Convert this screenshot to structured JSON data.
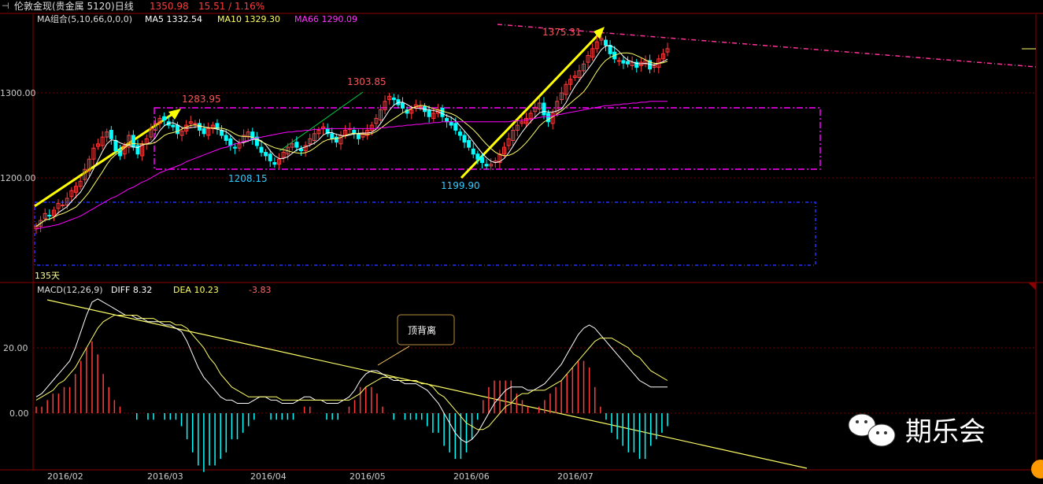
{
  "header": {
    "title": "伦敦金现(贵金属 5120)日线",
    "price": "1350.98",
    "change": "15.51 / 1.16%"
  },
  "ma_legend": {
    "label": "MA组合(5,10,66,0,0,0)",
    "ma5": "MA5 1332.54",
    "ma10": "MA10 1329.30",
    "ma66": "MA66 1290.09"
  },
  "macd_legend": {
    "label": "MACD(12,26,9)",
    "diff": "DIFF 8.32",
    "dea": "DEA 10.23",
    "macd": "-3.83"
  },
  "annotations": {
    "p1": "1283.95",
    "p2": "1303.85",
    "p3": "1375.31",
    "p4": "1208.15",
    "p5": "1199.90",
    "days": "135天",
    "divergence": "顶背离"
  },
  "watermark": {
    "brand": "期乐会"
  },
  "colors": {
    "up": "#ff3c3c",
    "down": "#00ffff",
    "ma5": "#ffffff",
    "ma10": "#ffff66",
    "ma66": "#ff00ff",
    "grid": "#7a0000",
    "arrow": "#ffff00"
  },
  "chart_data": [
    {
      "type": "candlestick",
      "title": "伦敦金现(贵金属 5120)日线",
      "ytick_labels": [
        "1300.00",
        "1200.00"
      ],
      "xtick_labels": [
        "2016/02",
        "2016/03",
        "2016/04",
        "2016/05",
        "2016/06",
        "2016/07"
      ],
      "ylim": [
        1130,
        1400
      ],
      "highs_lows": [
        {
          "label": "1283.95",
          "value": 1283.95
        },
        {
          "label": "1303.85",
          "value": 1303.85
        },
        {
          "label": "1375.31",
          "value": 1375.31
        },
        {
          "label": "1208.15",
          "value": 1208.15
        },
        {
          "label": "1199.90",
          "value": 1199.9
        }
      ],
      "close": [
        1143,
        1150,
        1158,
        1155,
        1162,
        1170,
        1168,
        1176,
        1185,
        1190,
        1196,
        1210,
        1222,
        1235,
        1240,
        1248,
        1254,
        1246,
        1232,
        1226,
        1238,
        1250,
        1236,
        1228,
        1240,
        1246,
        1258,
        1264,
        1270,
        1268,
        1262,
        1260,
        1252,
        1255,
        1262,
        1266,
        1264,
        1256,
        1252,
        1258,
        1262,
        1258,
        1250,
        1244,
        1238,
        1235,
        1240,
        1250,
        1254,
        1246,
        1238,
        1230,
        1226,
        1220,
        1216,
        1222,
        1230,
        1236,
        1240,
        1236,
        1232,
        1238,
        1246,
        1252,
        1256,
        1260,
        1252,
        1246,
        1242,
        1250,
        1256,
        1258,
        1252,
        1246,
        1252,
        1256,
        1262,
        1270,
        1280,
        1290,
        1296,
        1292,
        1286,
        1282,
        1276,
        1280,
        1286,
        1284,
        1278,
        1272,
        1276,
        1280,
        1272,
        1266,
        1262,
        1256,
        1250,
        1242,
        1236,
        1228,
        1222,
        1218,
        1214,
        1216,
        1220,
        1228,
        1236,
        1246,
        1256,
        1262,
        1266,
        1270,
        1276,
        1283,
        1288,
        1274,
        1266,
        1276,
        1290,
        1300,
        1310,
        1316,
        1320,
        1326,
        1334,
        1344,
        1352,
        1360,
        1364,
        1356,
        1346,
        1340,
        1338,
        1335,
        1334,
        1336,
        1330,
        1336,
        1338,
        1328,
        1332,
        1340,
        1346,
        1352
      ],
      "ma66": [
        1140,
        1141,
        1142,
        1143,
        1144,
        1145,
        1147,
        1149,
        1151,
        1153,
        1155,
        1158,
        1161,
        1164,
        1167,
        1170,
        1173,
        1176,
        1178,
        1181,
        1184,
        1187,
        1189,
        1192,
        1195,
        1197,
        1200,
        1203,
        1206,
        1208,
        1210,
        1212,
        1214,
        1216,
        1219,
        1221,
        1223,
        1225,
        1227,
        1229,
        1231,
        1233,
        1235,
        1236,
        1238,
        1240,
        1241,
        1243,
        1244,
        1246,
        1247,
        1248,
        1249,
        1250,
        1251,
        1252,
        1253,
        1254,
        1254,
        1255,
        1255,
        1256,
        1256,
        1257,
        1257,
        1258,
        1258,
        1258,
        1258,
        1258,
        1258,
        1258,
        1258,
        1258,
        1258,
        1258,
        1258,
        1258,
        1259,
        1259,
        1260,
        1260,
        1261,
        1261,
        1262,
        1262,
        1263,
        1263,
        1264,
        1264,
        1265,
        1265,
        1266,
        1266,
        1266,
        1266,
        1266,
        1266,
        1266,
        1266,
        1266,
        1266,
        1266,
        1266,
        1266,
        1266,
        1266,
        1266,
        1267,
        1267,
        1268,
        1268,
        1269,
        1270,
        1271,
        1272,
        1272,
        1273,
        1274,
        1275,
        1276,
        1277,
        1278,
        1279,
        1280,
        1281,
        1282,
        1283,
        1284,
        1285,
        1285,
        1286,
        1286,
        1287,
        1287,
        1288,
        1288,
        1289,
        1289,
        1290,
        1290,
        1290,
        1290,
        1290
      ]
    },
    {
      "type": "bar",
      "title": "MACD(12,26,9)",
      "ytick_labels": [
        "20.00",
        "0.00"
      ],
      "ylim": [
        -12,
        38
      ],
      "series": [
        {
          "name": "DIFF",
          "values": [
            5,
            6,
            8,
            10,
            12,
            14,
            16,
            20,
            25,
            30,
            34,
            35,
            34,
            33,
            32,
            31,
            30,
            30,
            29,
            29,
            28,
            28,
            28,
            27,
            27,
            26,
            25,
            22,
            18,
            14,
            11,
            9,
            7,
            5,
            4,
            4,
            3,
            3,
            3,
            4,
            5,
            5,
            4,
            4,
            3,
            3,
            3,
            4,
            5,
            5,
            4,
            4,
            3,
            3,
            3,
            4,
            5,
            7,
            10,
            12,
            13,
            13,
            12,
            11,
            10,
            10,
            9,
            9,
            9,
            8,
            7,
            5,
            3,
            0,
            -3,
            -6,
            -8,
            -9,
            -8,
            -6,
            -3,
            0,
            3,
            5,
            7,
            8,
            8,
            8,
            7,
            7,
            8,
            9,
            11,
            13,
            15,
            18,
            21,
            24,
            26,
            27,
            26,
            24,
            22,
            20,
            18,
            16,
            14,
            12,
            10,
            9,
            8,
            8,
            8,
            8
          ]
        },
        {
          "name": "DEA",
          "values": [
            4,
            5,
            6,
            7,
            9,
            10,
            12,
            14,
            17,
            20,
            23,
            26,
            28,
            29,
            30,
            30,
            30,
            30,
            30,
            29,
            29,
            29,
            28,
            28,
            28,
            27,
            27,
            26,
            24,
            22,
            20,
            17,
            15,
            12,
            10,
            8,
            7,
            6,
            5,
            5,
            5,
            5,
            5,
            5,
            4,
            4,
            4,
            4,
            4,
            4,
            4,
            4,
            4,
            4,
            4,
            4,
            4,
            5,
            6,
            8,
            9,
            10,
            11,
            11,
            11,
            10,
            10,
            10,
            10,
            9,
            9,
            8,
            6,
            5,
            3,
            1,
            -1,
            -3,
            -4,
            -5,
            -5,
            -4,
            -2,
            0,
            2,
            3,
            5,
            6,
            6,
            7,
            7,
            7,
            8,
            9,
            10,
            12,
            14,
            16,
            18,
            20,
            22,
            23,
            23,
            23,
            22,
            21,
            20,
            18,
            17,
            15,
            13,
            12,
            11,
            10
          ]
        },
        {
          "name": "MACD",
          "values": [
            2,
            2,
            4,
            6,
            6,
            8,
            8,
            12,
            16,
            20,
            22,
            18,
            12,
            8,
            4,
            2,
            0,
            0,
            -2,
            0,
            -2,
            -2,
            0,
            -2,
            -2,
            -2,
            -4,
            -8,
            -12,
            -16,
            -18,
            -16,
            -16,
            -14,
            -12,
            -8,
            -8,
            -6,
            -4,
            -2,
            0,
            0,
            -2,
            -2,
            -2,
            -2,
            -2,
            0,
            2,
            2,
            0,
            0,
            -2,
            -2,
            -2,
            0,
            2,
            4,
            8,
            8,
            8,
            6,
            2,
            0,
            -2,
            0,
            -2,
            -2,
            -2,
            -2,
            -4,
            -6,
            -6,
            -10,
            -12,
            -14,
            -14,
            -12,
            -8,
            -2,
            4,
            8,
            10,
            10,
            10,
            10,
            6,
            4,
            2,
            0,
            2,
            4,
            6,
            8,
            10,
            12,
            14,
            16,
            16,
            14,
            8,
            2,
            -2,
            -6,
            -8,
            -10,
            -12,
            -12,
            -14,
            -14,
            -10,
            -8,
            -6,
            -4
          ]
        }
      ]
    }
  ]
}
